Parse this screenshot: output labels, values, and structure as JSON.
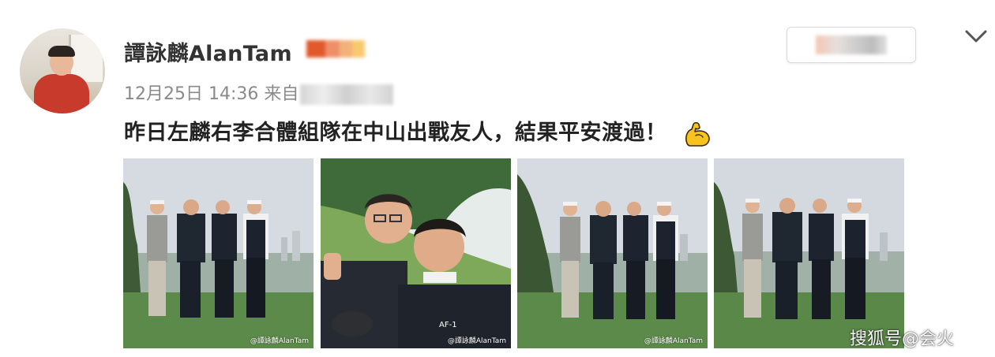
{
  "post": {
    "author_name": "譚詠麟AlanTam",
    "date": "12月25日",
    "time": "14:36",
    "source_prefix": "来自",
    "text": "昨日左麟右李合體組隊在中山出戰友人，結果平安渡過！",
    "emoji_icon": "flexed-biceps-icon"
  },
  "photos": [
    {
      "watermark": "@譚詠麟AlanTam"
    },
    {
      "watermark": "@譚詠麟AlanTam"
    },
    {
      "watermark": "@譚詠麟AlanTam"
    },
    {
      "watermark": "@譚詠麟AlanTam"
    }
  ],
  "overlay": {
    "source_watermark": "搜狐号@会火"
  },
  "colors": {
    "name_text": "#333333",
    "meta_text": "#8a8a8a",
    "body_text": "#222222",
    "jacket_red": "#c83a2c"
  }
}
